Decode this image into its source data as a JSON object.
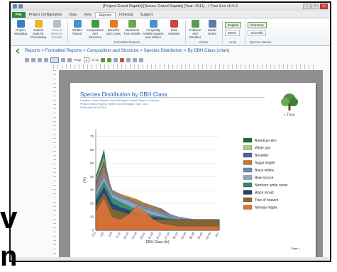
{
  "window": {
    "title": "[Project Grand Rapids] [Series: Grand Rapids] [Year: 2011] - i-Tree Eco v6.0.0",
    "controls": [
      "minimize",
      "maximize",
      "close"
    ]
  },
  "menu_tabs": [
    {
      "label": "File"
    },
    {
      "label": "Project Configuration"
    },
    {
      "label": "Data"
    },
    {
      "label": "View"
    },
    {
      "label": "Reports"
    },
    {
      "label": "Forecast"
    },
    {
      "label": "Support"
    }
  ],
  "ribbon": {
    "buttons": [
      {
        "label": "Project Metadata",
        "color": "#3a7fc4"
      },
      {
        "label": "Submit Data for Processing",
        "color": "#e8b62c"
      },
      {
        "label": "Track & Retrieve Results",
        "color": "#9fa8b3"
      },
      {
        "label": "Written Report",
        "color": "#4a8fd0"
      },
      {
        "label": "Composition and Structure",
        "color": "#3f9a47"
      },
      {
        "label": "Benefits and Costs",
        "color": "#e07b2a"
      },
      {
        "label": "Measured Tree Details",
        "color": "#6aa84f"
      },
      {
        "label": "Air Quality Health Impacts and Values",
        "color": "#4b8fce"
      },
      {
        "label": "Pest Analysis",
        "color": "#c9463d"
      },
      {
        "label": "Pollution and Weather",
        "color": "#5a9a55"
      },
      {
        "label": "Model Notes",
        "color": "#5a7fa8"
      }
    ],
    "groups": [
      "Formatted Reports",
      "Charts",
      "Units",
      "Species Names"
    ],
    "units": {
      "english": "English",
      "metric": "Metric"
    },
    "species_names": {
      "common": "Common",
      "scientific": "Scientific"
    }
  },
  "breadcrumb": "Reports > Formatted Reports > Composition and Structure > Species Distribution > By DBH Class (chart)",
  "toolbar": {
    "page_label": "Page",
    "page_value": "1",
    "page_of": "of 12",
    "zoom": "100"
  },
  "report": {
    "title": "Species Distribution by DBH Class",
    "subtitle_lines": [
      "Location: Grand Rapids, Kent, Michigan, United States of America",
      "Project: Grand Rapids, Series: Grand Rapids, Year: 2011",
      "Generated: 9/15/2016"
    ],
    "logo_text": "i-Tree",
    "page_number": "Page 1"
  },
  "chart_data": {
    "type": "area",
    "xlabel": "DBH Class (in)",
    "ylabel": "(%)",
    "y_ticks": [
      0,
      10,
      20,
      30,
      40,
      50,
      60,
      70
    ],
    "ylim": [
      0,
      75
    ],
    "categories": [
      "0-3",
      "3-6",
      "6-9",
      "9-12",
      "12-15",
      "15-18",
      "18-21",
      "21-24",
      "24-27",
      "27-30",
      "30-33",
      "33-36",
      "36-39",
      "39-42",
      "42-45",
      "45+"
    ],
    "series": [
      {
        "name": "American elm",
        "color": "#1e6b3c",
        "values": [
          40,
          60,
          14,
          12,
          10,
          9,
          8,
          8,
          8,
          8,
          8,
          8,
          8,
          8,
          8,
          8
        ]
      },
      {
        "name": "White ash",
        "color": "#a8cf72",
        "values": [
          38,
          55,
          26,
          22,
          20,
          18,
          15,
          13,
          12,
          10,
          9,
          8,
          8,
          8,
          8,
          8
        ]
      },
      {
        "name": "Boxelder",
        "color": "#5b5ea6",
        "values": [
          36,
          52,
          28,
          25,
          24,
          22,
          20,
          18,
          16,
          12,
          9,
          8,
          8,
          8,
          8,
          8
        ]
      },
      {
        "name": "Sugar maple",
        "color": "#c27a2e",
        "values": [
          33,
          48,
          30,
          27,
          25,
          23,
          20,
          18,
          15,
          12,
          9,
          8,
          8,
          8,
          8,
          8
        ]
      },
      {
        "name": "Black willow",
        "color": "#6e8fb8",
        "values": [
          30,
          44,
          29,
          26,
          23,
          20,
          18,
          16,
          14,
          12,
          10,
          9,
          8,
          8,
          8,
          8
        ]
      },
      {
        "name": "Blue spruce",
        "color": "#8fa7c0",
        "values": [
          28,
          40,
          27,
          24,
          22,
          19,
          16,
          14,
          12,
          10,
          9,
          8,
          8,
          8,
          8,
          8
        ]
      },
      {
        "name": "Northern white cedar",
        "color": "#2e8a6a",
        "values": [
          25,
          36,
          24,
          21,
          18,
          15,
          13,
          11,
          10,
          9,
          8,
          8,
          8,
          8,
          8,
          8
        ]
      },
      {
        "name": "Black locust",
        "color": "#2a3f7a",
        "values": [
          22,
          32,
          20,
          17,
          15,
          13,
          11,
          10,
          9,
          8,
          8,
          8,
          8,
          8,
          8,
          8
        ]
      },
      {
        "name": "Tree of heaven",
        "color": "#8a6a2a",
        "values": [
          18,
          28,
          16,
          14,
          12,
          10,
          9,
          8,
          8,
          8,
          8,
          8,
          8,
          8,
          8,
          8
        ]
      },
      {
        "name": "Norway maple",
        "color": "#e0733a",
        "values": [
          14,
          24,
          10,
          8,
          12,
          18,
          14,
          8,
          5,
          4,
          3,
          3,
          3,
          3,
          3,
          3
        ]
      }
    ],
    "legend_position": "right"
  },
  "overlay": {
    "text_fragment_1": "v",
    "text_fragment_2": "n"
  },
  "colors": {
    "accent": "#2e8b3a",
    "link": "#2060a8",
    "page_background": "#8f8f8f"
  }
}
